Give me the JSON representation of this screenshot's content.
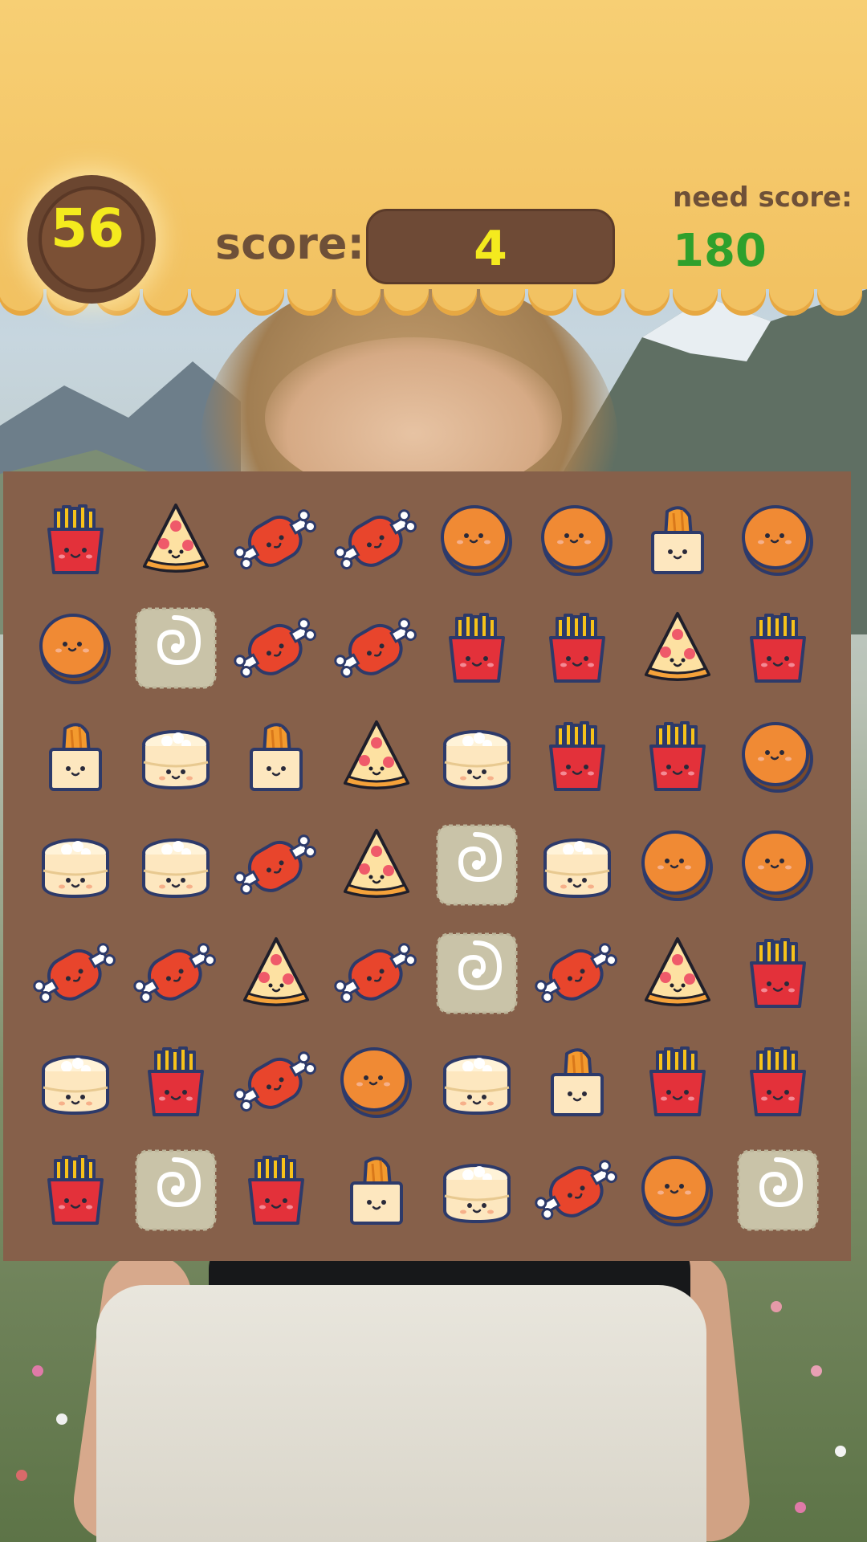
{
  "hud": {
    "moves_left": "56",
    "score_label": "score:",
    "score_value": "4",
    "need_score_label": "need score:",
    "need_score_value": "180"
  },
  "board": {
    "columns": 8,
    "rows": 7,
    "grid": [
      [
        "fries",
        "pizza",
        "meat",
        "meat",
        "pancake",
        "pancake",
        "bread",
        "pancake"
      ],
      [
        "pancake",
        "cracker",
        "meat",
        "meat",
        "fries",
        "fries",
        "pizza",
        "fries"
      ],
      [
        "bread",
        "bun",
        "bread",
        "pizza",
        "bun",
        "fries",
        "fries",
        "pancake"
      ],
      [
        "bun",
        "bun",
        "meat",
        "pizza",
        "cracker",
        "bun",
        "pancake",
        "pancake"
      ],
      [
        "meat",
        "meat",
        "pizza",
        "meat",
        "cracker",
        "meat",
        "pizza",
        "fries"
      ],
      [
        "bun",
        "fries",
        "meat",
        "pancake",
        "bun",
        "bread",
        "fries",
        "fries"
      ],
      [
        "fries",
        "cracker",
        "fries",
        "bread",
        "bun",
        "meat",
        "pancake",
        "cracker"
      ]
    ]
  },
  "colors": {
    "header": "#f2c262",
    "board": "#86604a",
    "score_text": "#f4ea1e",
    "need_score_text": "#2fa02c",
    "label_text": "#6e5038"
  },
  "icons": {
    "fries": "fries-icon",
    "pizza": "pizza-slice-icon",
    "meat": "meat-drumstick-icon",
    "pancake": "pancake-icon",
    "bread": "bread-loaf-icon",
    "cracker": "spiral-cracker-icon",
    "bun": "steamed-bun-icon"
  }
}
